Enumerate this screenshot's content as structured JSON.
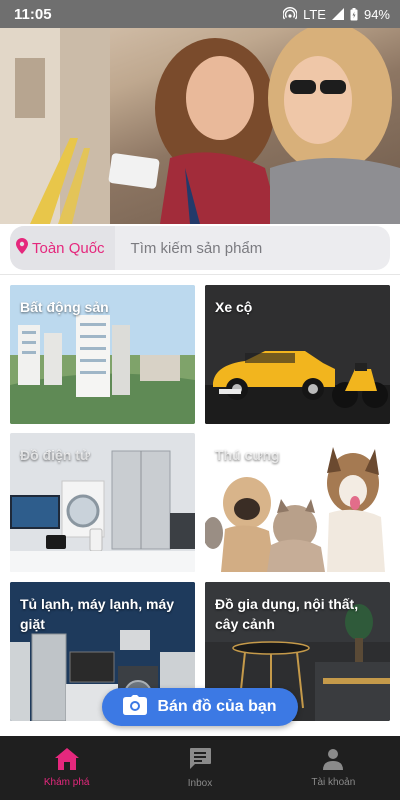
{
  "status_bar": {
    "time": "11:05",
    "network": "LTE",
    "battery": "94%",
    "icons": [
      "hotspot-icon",
      "signal-icon",
      "battery-icon"
    ]
  },
  "search": {
    "location_label": "Toàn Quốc",
    "placeholder": "Tìm kiếm sản phẩm",
    "location_icon": "location-pin-icon"
  },
  "categories": [
    {
      "label": "Bất động sản"
    },
    {
      "label": "Xe cộ"
    },
    {
      "label": "Đồ điện tử"
    },
    {
      "label": "Thú cưng"
    },
    {
      "label": "Tủ lạnh, máy lạnh, máy giặt"
    },
    {
      "label": "Đồ gia dụng, nội thất, cây cảnh"
    }
  ],
  "sell_button": {
    "label": "Bán đồ của bạn",
    "icon": "camera-icon"
  },
  "bottom_nav": [
    {
      "label": "Khám phá",
      "icon": "home-icon",
      "active": true
    },
    {
      "label": "Inbox",
      "icon": "chat-icon",
      "active": false
    },
    {
      "label": "Tài khoản",
      "icon": "account-icon",
      "active": false
    }
  ],
  "colors": {
    "accent_pink": "#e5287d",
    "sell_blue": "#3c79e4",
    "status_bar": "#6f6f6f",
    "nav_bg": "#1f1f1f"
  }
}
